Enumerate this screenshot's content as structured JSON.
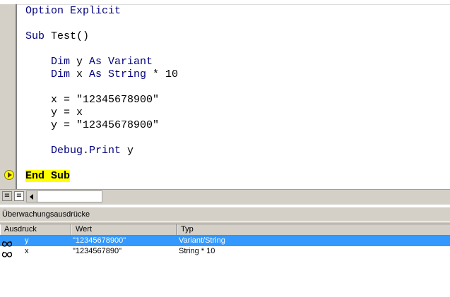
{
  "code": {
    "lines": [
      {
        "parts": [
          {
            "t": "Option Explicit",
            "c": "kw"
          }
        ]
      },
      {
        "parts": [
          {
            "t": "Sub ",
            "c": "kw"
          },
          {
            "t": "Test()",
            "c": "tx"
          }
        ]
      },
      {
        "parts": [
          {
            "t": "    Dim ",
            "c": "kw"
          },
          {
            "t": "y ",
            "c": "tx"
          },
          {
            "t": "As Variant",
            "c": "kw"
          }
        ]
      },
      {
        "parts": [
          {
            "t": "    Dim ",
            "c": "kw"
          },
          {
            "t": "x ",
            "c": "tx"
          },
          {
            "t": "As String",
            "c": "kw"
          },
          {
            "t": " * 10",
            "c": "tx"
          }
        ]
      },
      {
        "parts": [
          {
            "t": "    x = \"12345678900\"",
            "c": "tx"
          }
        ]
      },
      {
        "parts": [
          {
            "t": "    y = x",
            "c": "tx"
          }
        ]
      },
      {
        "parts": [
          {
            "t": "    y = \"12345678900\"",
            "c": "tx"
          }
        ]
      },
      {
        "parts": [
          {
            "t": "    Debug",
            "c": "kw"
          },
          {
            "t": ".",
            "c": "tx"
          },
          {
            "t": "Print",
            "c": "kw"
          },
          {
            "t": " y",
            "c": "tx"
          }
        ]
      },
      {
        "parts": [
          {
            "t": "End Sub",
            "c": "hl"
          }
        ]
      }
    ],
    "highlight_color": "#ffff00",
    "keyword_color": "#00007f"
  },
  "watch": {
    "title": "Überwachungsausdrücke",
    "columns": [
      "Ausdruck",
      "Wert",
      "Typ"
    ],
    "rows": [
      {
        "expr": "y",
        "value": "\"12345678900\"",
        "type": "Variant/String",
        "selected": true,
        "icon": "watch-glasses-icon"
      },
      {
        "expr": "x",
        "value": "\"1234567890\"",
        "type": "String * 10",
        "selected": false,
        "icon": "watch-glasses-icon"
      }
    ],
    "selection_color": "#3399ff"
  }
}
